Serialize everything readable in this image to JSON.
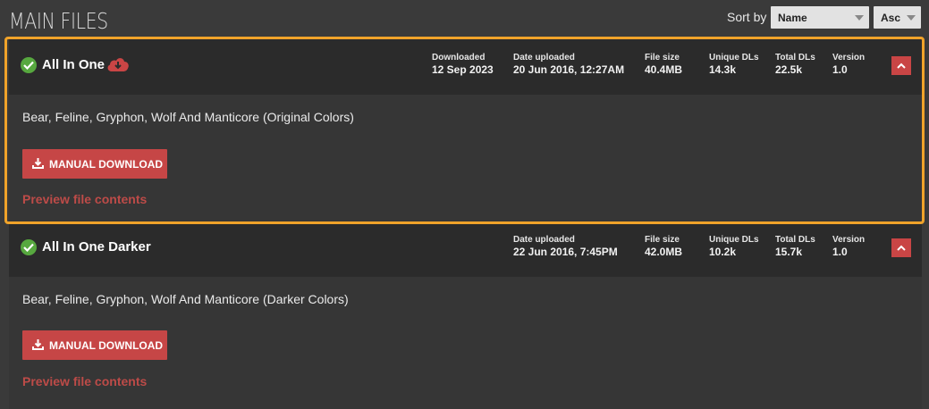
{
  "section_title": "MAIN FILES",
  "sort": {
    "label": "Sort by",
    "field_value": "Name",
    "order_value": "Asc"
  },
  "files": [
    {
      "name": "All In One",
      "downloaded_label": "Downloaded",
      "downloaded": "12 Sep 2023",
      "uploaded_label": "Date uploaded",
      "uploaded": "20 Jun 2016, 12:27AM",
      "size_label": "File size",
      "size": "40.4MB",
      "unique_label": "Unique DLs",
      "unique": "14.3k",
      "total_label": "Total DLs",
      "total": "22.5k",
      "version_label": "Version",
      "version": "1.0",
      "description": "Bear, Feline, Gryphon, Wolf And Manticore (Original Colors)",
      "download_button": "MANUAL DOWNLOAD",
      "preview_link": "Preview file contents"
    },
    {
      "name": "All In One Darker",
      "uploaded_label": "Date uploaded",
      "uploaded": "22 Jun 2016, 7:45PM",
      "size_label": "File size",
      "size": "42.0MB",
      "unique_label": "Unique DLs",
      "unique": "10.2k",
      "total_label": "Total DLs",
      "total": "15.7k",
      "version_label": "Version",
      "version": "1.0",
      "description": "Bear, Feline, Gryphon, Wolf And Manticore (Darker Colors)",
      "download_button": "MANUAL DOWNLOAD",
      "preview_link": "Preview file contents"
    }
  ],
  "colors": {
    "accent": "#c64646",
    "highlight": "#f0a32a",
    "check": "#57a83f"
  }
}
